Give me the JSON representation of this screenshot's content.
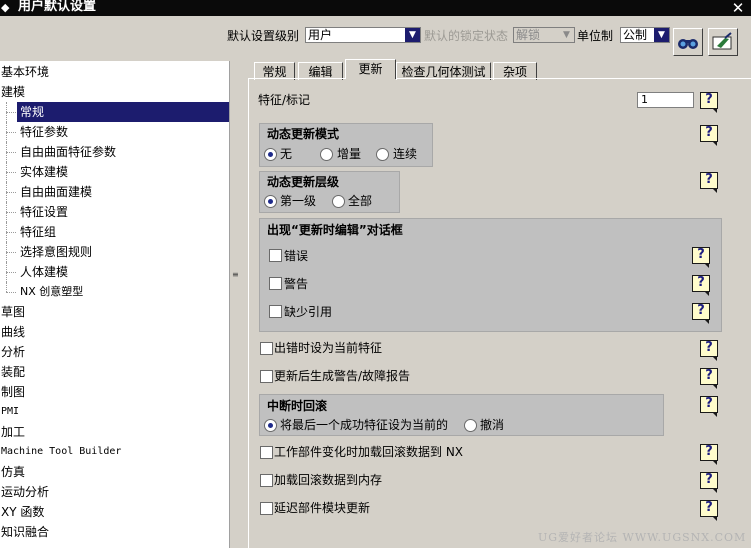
{
  "window": {
    "title": "用户默认设置",
    "close_icon": "close-icon"
  },
  "toolbar": {
    "level_label": "默认设置级别",
    "level_value": "用户",
    "lock_label": "默认的锁定状态",
    "lock_value": "解锁",
    "unit_label": "单位制",
    "unit_value": "公制",
    "btn1_icon": "binoculars-icon",
    "btn2_icon": "manage-icon"
  },
  "tree": {
    "items": [
      "基本环境",
      "建模",
      "常规",
      "特征参数",
      "自由曲面特征参数",
      "实体建模",
      "自由曲面建模",
      "特征设置",
      "特征组",
      "选择意图规则",
      "人体建模",
      "NX 创意塑型",
      "草图",
      "曲线",
      "分析",
      "装配",
      "制图",
      "PMI",
      "加工",
      "Machine Tool Builder",
      "仿真",
      "运动分析",
      "XY 函数",
      "知识融合"
    ],
    "selected": "常规"
  },
  "tabs": [
    "常规",
    "编辑",
    "更新",
    "检查几何体测试",
    "杂项"
  ],
  "active_tab": "更新",
  "update": {
    "feature_label": "特征/标记",
    "feature_value": "1",
    "dyn_mode": {
      "title": "动态更新模式",
      "options": [
        "无",
        "增量",
        "连续"
      ],
      "selected": "无"
    },
    "dyn_level": {
      "title": "动态更新层级",
      "options": [
        "第一级",
        "全部"
      ],
      "selected": "第一级"
    },
    "edit_dialog": {
      "title": "出现“更新时编辑”对话框",
      "items": [
        "错误",
        "警告",
        "缺少引用"
      ]
    },
    "opt_error_current": "出错时设为当前特征",
    "opt_gen_report": "更新后生成警告/故障报告",
    "interrupt": {
      "title": "中断时回滚",
      "options": [
        "将最后一个成功特征设为当前的",
        "撤消"
      ],
      "selected": "将最后一个成功特征设为当前的"
    },
    "opt_load_rollback": "工作部件变化时加载回滚数据到 NX",
    "opt_load_memory": "加载回滚数据到内存",
    "opt_delay_update": "延迟部件模块更新",
    "help_text": "?"
  },
  "watermark": "UG爱好者论坛 WWW.UGSNX.COM"
}
